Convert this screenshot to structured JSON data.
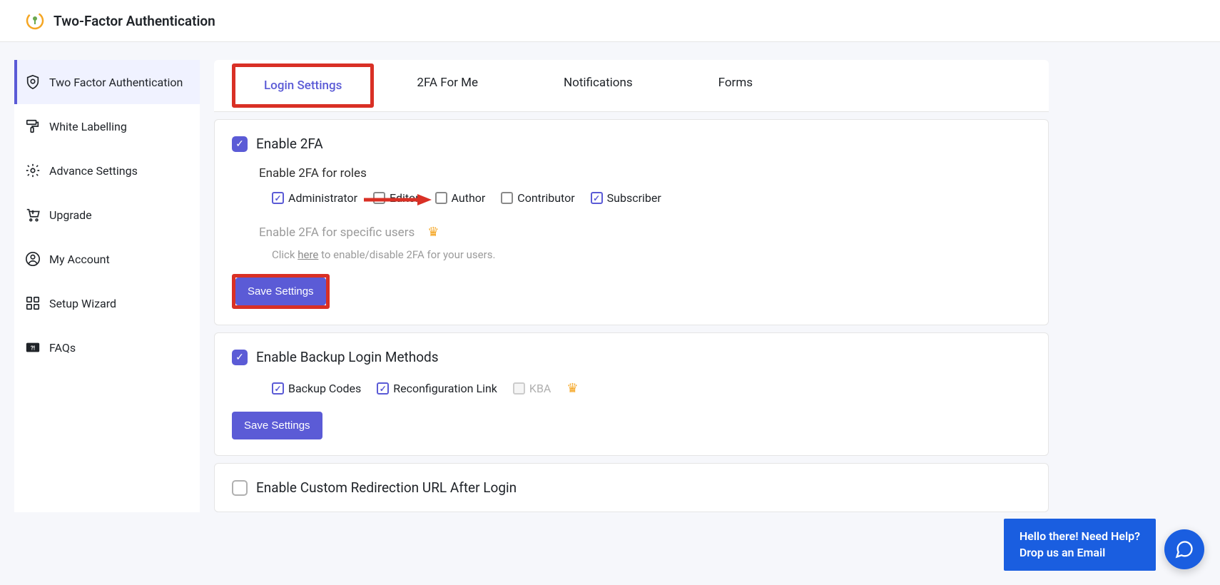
{
  "header": {
    "title": "Two-Factor Authentication"
  },
  "sidebar": {
    "items": [
      {
        "label": "Two Factor Authentication"
      },
      {
        "label": "White Labelling"
      },
      {
        "label": "Advance Settings"
      },
      {
        "label": "Upgrade"
      },
      {
        "label": "My Account"
      },
      {
        "label": "Setup Wizard"
      },
      {
        "label": "FAQs"
      }
    ]
  },
  "tabs": [
    {
      "label": "Login Settings"
    },
    {
      "label": "2FA For Me"
    },
    {
      "label": "Notifications"
    },
    {
      "label": "Forms"
    }
  ],
  "card1": {
    "title": "Enable 2FA",
    "roles_title": "Enable 2FA for roles",
    "roles": [
      {
        "label": "Administrator",
        "checked": true
      },
      {
        "label": "Editor",
        "checked": false
      },
      {
        "label": "Author",
        "checked": false
      },
      {
        "label": "Contributor",
        "checked": false
      },
      {
        "label": "Subscriber",
        "checked": true
      }
    ],
    "specific_title": "Enable 2FA for specific users",
    "specific_sub_prefix": "Click ",
    "specific_sub_link": "here",
    "specific_sub_suffix": " to enable/disable 2FA for your users.",
    "save_label": "Save Settings"
  },
  "card2": {
    "title": "Enable Backup Login Methods",
    "options": [
      {
        "label": "Backup Codes",
        "checked": true
      },
      {
        "label": "Reconfiguration Link",
        "checked": true
      }
    ],
    "kba_label": "KBA",
    "save_label": "Save Settings"
  },
  "card3": {
    "title": "Enable Custom Redirection URL After Login"
  },
  "help": {
    "line1": "Hello there! Need Help?",
    "line2": "Drop us an Email"
  }
}
